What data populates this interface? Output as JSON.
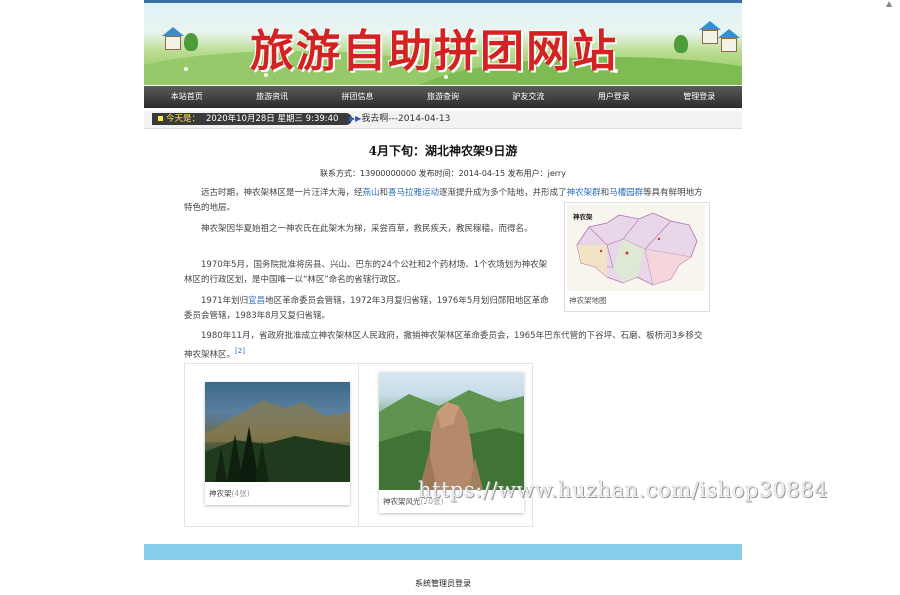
{
  "site": {
    "banner_title": "旅游自助拼团网站"
  },
  "nav": [
    "本站首页",
    "旅游资讯",
    "拼团信息",
    "旅游查询",
    "驴友交流",
    "用户登录",
    "管理登录"
  ],
  "datebar": {
    "label": "今天是：",
    "datetime": "2020年10月28日 星期三 9:39:40",
    "ticker": "我去啊---2014-04-13"
  },
  "article": {
    "title": "4月下旬：湖北神农架9日游",
    "meta": "联系方式：13900000000 发布时间：2014-04-15 发布用户：jerry",
    "p1": {
      "a": "远古时期，神农架林区是一片汪洋大海，经",
      "link1": "燕山",
      "b": "和",
      "link2": "喜马拉雅运动",
      "c": "逐渐提升成为多个陆地，并形成了",
      "link3": "神农架群",
      "d": "和",
      "link4": "马槽园群",
      "e": "等具有鲜明地方特色的地层。"
    },
    "p2": "神农架因华夏始祖之一神农氏在此架木为梯，采尝百草，救民疾夭，教民稼穑，而得名。",
    "p3": "1970年5月，国务院批准将房县、兴山、巴东的24个公社和2个药材场、1个农场划为神农架林区的行政区划，是中国唯一以“林区”命名的省辖行政区。",
    "p4": {
      "a": "1971年划归",
      "link": "宜昌",
      "b": "地区革命委员会管辖，1972年3月复归省辖，1976年5月划归郧阳地区革命委员会管辖，1983年8月又复归省辖。"
    },
    "p5": "1980年11月，省政府批准成立神农架林区人民政府，撤销神农架林区革命委员会，1965年巴东代管的下谷坪、石磨、板桥河3乡移交神农架林区。",
    "p5_ref": "[2]"
  },
  "map": {
    "label": "神农架",
    "caption": "神农架地图"
  },
  "gallery": [
    {
      "caption": "神农架",
      "count": "(4张)"
    },
    {
      "caption": "神农架风光",
      "count": "(20张)"
    }
  ],
  "footer": {
    "admin_login": "系统管理员登录"
  },
  "watermark": "https://www.huzhan.com/ishop30884",
  "colors": {
    "banner_title": "#d42222",
    "nav_bg": "#3a3a3a",
    "link": "#2a6cb8",
    "bottom_bar": "#87ceeb"
  }
}
